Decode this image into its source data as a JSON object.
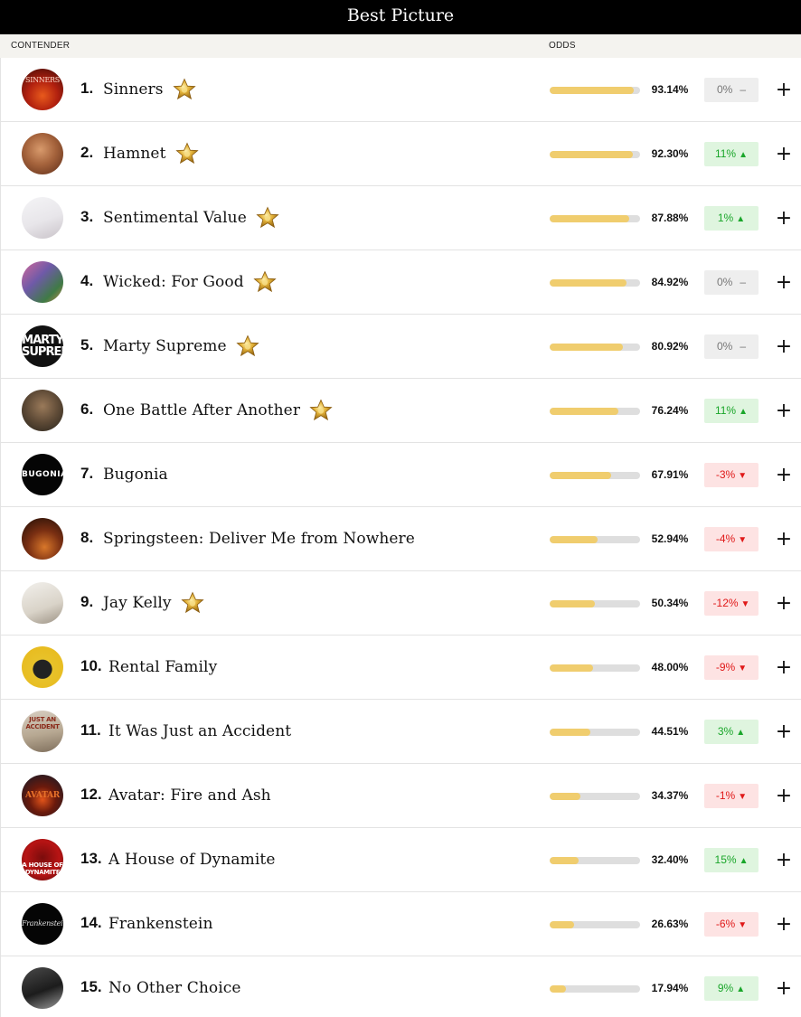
{
  "header": {
    "title": "Best Picture"
  },
  "columns": {
    "contender": "CONTENDER",
    "odds": "ODDS"
  },
  "colors": {
    "bar_fill": "#f0cd6e",
    "bar_track": "#dedede",
    "up": "#1aa62a",
    "down": "#e01919"
  },
  "rows": [
    {
      "rank": "1.",
      "name": "Sinners",
      "star": true,
      "odds_fraction": 0.9314,
      "pct": "93.14%",
      "change": "0%",
      "dir": "flat",
      "poster": "sinners-poster",
      "poster_text": "SINNERS"
    },
    {
      "rank": "2.",
      "name": "Hamnet",
      "star": true,
      "odds_fraction": 0.923,
      "pct": "92.30%",
      "change": "11%",
      "dir": "up",
      "poster": "hamnet-poster",
      "poster_text": ""
    },
    {
      "rank": "3.",
      "name": "Sentimental Value",
      "star": true,
      "odds_fraction": 0.8788,
      "pct": "87.88%",
      "change": "1%",
      "dir": "up",
      "poster": "sentimental-value-poster",
      "poster_text": ""
    },
    {
      "rank": "4.",
      "name": "Wicked: For Good",
      "star": true,
      "odds_fraction": 0.8492,
      "pct": "84.92%",
      "change": "0%",
      "dir": "flat",
      "poster": "wicked-poster",
      "poster_text": ""
    },
    {
      "rank": "5.",
      "name": "Marty Supreme",
      "star": true,
      "odds_fraction": 0.8092,
      "pct": "80.92%",
      "change": "0%",
      "dir": "flat",
      "poster": "marty-supreme-poster",
      "poster_text": "MARTY SUPREME"
    },
    {
      "rank": "6.",
      "name": "One Battle After Another",
      "star": true,
      "odds_fraction": 0.7624,
      "pct": "76.24%",
      "change": "11%",
      "dir": "up",
      "poster": "one-battle-poster",
      "poster_text": ""
    },
    {
      "rank": "7.",
      "name": "Bugonia",
      "star": false,
      "odds_fraction": 0.6791,
      "pct": "67.91%",
      "change": "-3%",
      "dir": "down",
      "poster": "bugonia-poster",
      "poster_text": "BUGONIA"
    },
    {
      "rank": "8.",
      "name": "Springsteen: Deliver Me from Nowhere",
      "star": false,
      "odds_fraction": 0.5294,
      "pct": "52.94%",
      "change": "-4%",
      "dir": "down",
      "poster": "springsteen-poster",
      "poster_text": ""
    },
    {
      "rank": "9.",
      "name": "Jay Kelly",
      "star": true,
      "odds_fraction": 0.5034,
      "pct": "50.34%",
      "change": "-12%",
      "dir": "down",
      "poster": "jay-kelly-poster",
      "poster_text": ""
    },
    {
      "rank": "10.",
      "name": "Rental Family",
      "star": false,
      "odds_fraction": 0.48,
      "pct": "48.00%",
      "change": "-9%",
      "dir": "down",
      "poster": "rental-family-poster",
      "poster_text": ""
    },
    {
      "rank": "11.",
      "name": "It Was Just an Accident",
      "star": false,
      "odds_fraction": 0.4451,
      "pct": "44.51%",
      "change": "3%",
      "dir": "up",
      "poster": "just-an-accident-poster",
      "poster_text": "JUST AN ACCIDENT"
    },
    {
      "rank": "12.",
      "name": "Avatar: Fire and Ash",
      "star": false,
      "odds_fraction": 0.3437,
      "pct": "34.37%",
      "change": "-1%",
      "dir": "down",
      "poster": "avatar-poster",
      "poster_text": "AVATAR"
    },
    {
      "rank": "13.",
      "name": "A House of Dynamite",
      "star": false,
      "odds_fraction": 0.324,
      "pct": "32.40%",
      "change": "15%",
      "dir": "up",
      "poster": "house-of-dynamite-poster",
      "poster_text": "A HOUSE OF DYNAMITE"
    },
    {
      "rank": "14.",
      "name": "Frankenstein",
      "star": false,
      "odds_fraction": 0.2663,
      "pct": "26.63%",
      "change": "-6%",
      "dir": "down",
      "poster": "frankenstein-poster",
      "poster_text": "Frankenstein"
    },
    {
      "rank": "15.",
      "name": "No Other Choice",
      "star": false,
      "odds_fraction": 0.1794,
      "pct": "17.94%",
      "change": "9%",
      "dir": "up",
      "poster": "no-other-choice-poster",
      "poster_text": ""
    }
  ],
  "icons": {
    "star": "gold-star-icon",
    "up": "triangle-up-icon",
    "down": "triangle-down-icon",
    "flat": "dash-icon",
    "add": "plus-icon"
  },
  "glyphs": {
    "up": "▲",
    "down": "▼",
    "flat": "–",
    "add": "+"
  }
}
